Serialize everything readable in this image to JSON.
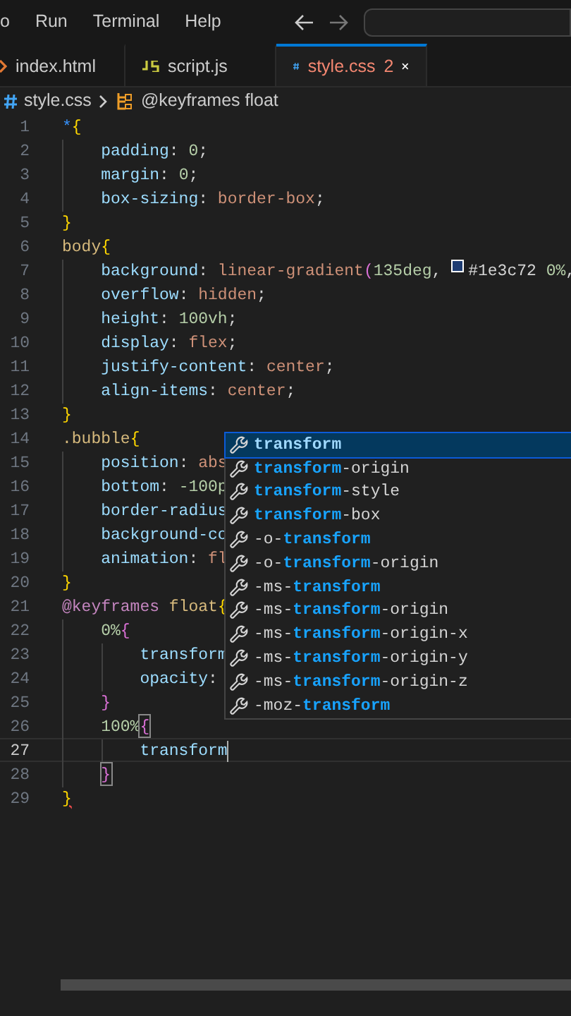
{
  "menu_bar": {
    "items": [
      "o",
      "Run",
      "Terminal",
      "Help"
    ]
  },
  "tabs": [
    {
      "label": "index.html",
      "kind": "html",
      "selected": false
    },
    {
      "label": "script.js",
      "kind": "js",
      "selected": false
    },
    {
      "label": "style.css",
      "kind": "css",
      "selected": true,
      "errors": "2"
    }
  ],
  "breadcrumb": {
    "file": "style.css",
    "symbol": "@keyframes float"
  },
  "editor": {
    "lines": [
      {
        "number": "1",
        "active": false,
        "tokens": [
          {
            "t": "*",
            "kind": "star"
          },
          {
            "t": "{",
            "kind": "b1"
          }
        ]
      },
      {
        "number": "2",
        "active": false,
        "tokens": [
          {
            "t": "    padding",
            "kind": "prop"
          },
          {
            "t": ": ",
            "kind": "p"
          },
          {
            "t": "0",
            "kind": "num"
          },
          {
            "t": ";",
            "kind": "p"
          }
        ]
      },
      {
        "number": "3",
        "active": false,
        "tokens": [
          {
            "t": "    margin",
            "kind": "prop"
          },
          {
            "t": ": ",
            "kind": "p"
          },
          {
            "t": "0",
            "kind": "num"
          },
          {
            "t": ";",
            "kind": "p"
          }
        ]
      },
      {
        "number": "4",
        "active": false,
        "tokens": [
          {
            "t": "    box-sizing",
            "kind": "prop"
          },
          {
            "t": ": ",
            "kind": "p"
          },
          {
            "t": "border-box",
            "kind": "val"
          },
          {
            "t": ";",
            "kind": "p"
          }
        ]
      },
      {
        "number": "5",
        "active": false,
        "tokens": [
          {
            "t": "}",
            "kind": "b1"
          }
        ]
      },
      {
        "number": "6",
        "active": false,
        "tokens": [
          {
            "t": "body",
            "kind": "sel"
          },
          {
            "t": "{",
            "kind": "b1"
          }
        ]
      },
      {
        "number": "7",
        "active": false,
        "tokens": [
          {
            "t": "    background",
            "kind": "prop"
          },
          {
            "t": ": ",
            "kind": "p"
          },
          {
            "t": "linear-gradient",
            "kind": "val"
          },
          {
            "t": "(",
            "kind": "b2"
          },
          {
            "t": "135deg",
            "kind": "num"
          },
          {
            "t": ", ",
            "kind": "p"
          },
          {
            "kind": "swatch",
            "color": "#1e3c72"
          },
          {
            "t": "#1e3c72 ",
            "kind": "p"
          },
          {
            "t": "0%",
            "kind": "num"
          },
          {
            "t": ",",
            "kind": "p"
          }
        ]
      },
      {
        "number": "8",
        "active": false,
        "tokens": [
          {
            "t": "    overflow",
            "kind": "prop"
          },
          {
            "t": ": ",
            "kind": "p"
          },
          {
            "t": "hidden",
            "kind": "val"
          },
          {
            "t": ";",
            "kind": "p"
          }
        ]
      },
      {
        "number": "9",
        "active": false,
        "tokens": [
          {
            "t": "    height",
            "kind": "prop"
          },
          {
            "t": ": ",
            "kind": "p"
          },
          {
            "t": "100vh",
            "kind": "num"
          },
          {
            "t": ";",
            "kind": "p"
          }
        ]
      },
      {
        "number": "10",
        "active": false,
        "tokens": [
          {
            "t": "    display",
            "kind": "prop"
          },
          {
            "t": ": ",
            "kind": "p"
          },
          {
            "t": "flex",
            "kind": "val"
          },
          {
            "t": ";",
            "kind": "p"
          }
        ]
      },
      {
        "number": "11",
        "active": false,
        "tokens": [
          {
            "t": "    justify-content",
            "kind": "prop"
          },
          {
            "t": ": ",
            "kind": "p"
          },
          {
            "t": "center",
            "kind": "val"
          },
          {
            "t": ";",
            "kind": "p"
          }
        ]
      },
      {
        "number": "12",
        "active": false,
        "tokens": [
          {
            "t": "    align-items",
            "kind": "prop"
          },
          {
            "t": ": ",
            "kind": "p"
          },
          {
            "t": "center",
            "kind": "val"
          },
          {
            "t": ";",
            "kind": "p"
          }
        ]
      },
      {
        "number": "13",
        "active": false,
        "tokens": [
          {
            "t": "}",
            "kind": "b1"
          }
        ]
      },
      {
        "number": "14",
        "active": false,
        "tokens": [
          {
            "t": ".bubble",
            "kind": "sel"
          },
          {
            "t": "{",
            "kind": "b1"
          }
        ]
      },
      {
        "number": "15",
        "active": false,
        "tokens": [
          {
            "t": "    position",
            "kind": "prop"
          },
          {
            "t": ": ",
            "kind": "p"
          },
          {
            "t": "abs",
            "kind": "val"
          }
        ]
      },
      {
        "number": "16",
        "active": false,
        "tokens": [
          {
            "t": "    bottom",
            "kind": "prop"
          },
          {
            "t": ": ",
            "kind": "p"
          },
          {
            "t": "-100p",
            "kind": "num"
          }
        ]
      },
      {
        "number": "17",
        "active": false,
        "tokens": [
          {
            "t": "    border-radius",
            "kind": "prop"
          }
        ]
      },
      {
        "number": "18",
        "active": false,
        "tokens": [
          {
            "t": "    background-co",
            "kind": "prop"
          }
        ]
      },
      {
        "number": "19",
        "active": false,
        "tokens": [
          {
            "t": "    animation",
            "kind": "prop"
          },
          {
            "t": ": ",
            "kind": "p"
          },
          {
            "t": "fl",
            "kind": "val"
          }
        ]
      },
      {
        "number": "20",
        "active": false,
        "tokens": [
          {
            "t": "}",
            "kind": "b1"
          }
        ]
      },
      {
        "number": "21",
        "active": false,
        "tokens": [
          {
            "t": "@keyframes",
            "kind": "at"
          },
          {
            "t": " float",
            "kind": "sel"
          },
          {
            "t": "{",
            "kind": "b1"
          }
        ]
      },
      {
        "number": "22",
        "active": false,
        "tokens": [
          {
            "t": "    0%",
            "kind": "num"
          },
          {
            "t": "{",
            "kind": "b2"
          }
        ]
      },
      {
        "number": "23",
        "active": false,
        "tokens": [
          {
            "t": "        transform",
            "kind": "prop"
          }
        ]
      },
      {
        "number": "24",
        "active": false,
        "tokens": [
          {
            "t": "        opacity",
            "kind": "prop"
          },
          {
            "t": ": ",
            "kind": "p"
          }
        ]
      },
      {
        "number": "25",
        "active": false,
        "tokens": [
          {
            "t": "    }",
            "kind": "b2"
          }
        ]
      },
      {
        "number": "26",
        "active": false,
        "tokens": [
          {
            "t": "    100%",
            "kind": "num"
          },
          {
            "t": "{",
            "kind": "b2",
            "boxed": true
          }
        ]
      },
      {
        "number": "27",
        "active": true,
        "tokens": [
          {
            "t": "        transform",
            "kind": "prop"
          }
        ]
      },
      {
        "number": "28",
        "active": false,
        "tokens": [
          {
            "t": "    }",
            "kind": "b2",
            "boxed": true
          }
        ]
      },
      {
        "number": "29",
        "active": false,
        "tokens": [
          {
            "t": "}",
            "kind": "b1",
            "squiggle": true
          }
        ]
      }
    ]
  },
  "suggestions": [
    {
      "match": "transform",
      "selected": true
    },
    {
      "match": "transform",
      "post": "-origin",
      "selected": false
    },
    {
      "match": "transform",
      "post": "-style",
      "selected": false
    },
    {
      "match": "transform",
      "post": "-box",
      "selected": false
    },
    {
      "pre": "-o-",
      "match": "transform",
      "selected": false
    },
    {
      "pre": "-o-",
      "match": "transform",
      "post": "-origin",
      "selected": false
    },
    {
      "pre": "-ms-",
      "match": "transform",
      "selected": false
    },
    {
      "pre": "-ms-",
      "match": "transform",
      "post": "-origin",
      "selected": false
    },
    {
      "pre": "-ms-",
      "match": "transform",
      "post": "-origin-x",
      "selected": false
    },
    {
      "pre": "-ms-",
      "match": "transform",
      "post": "-origin-y",
      "selected": false
    },
    {
      "pre": "-ms-",
      "match": "transform",
      "post": "-origin-z",
      "selected": false
    },
    {
      "pre": "-moz-",
      "match": "transform",
      "selected": false
    }
  ]
}
